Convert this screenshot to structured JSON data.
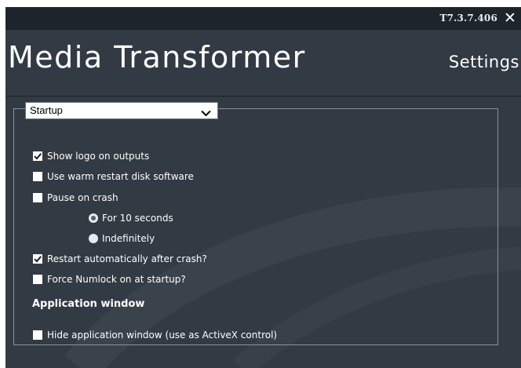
{
  "titlebar": {
    "version": "T7.3.7.406",
    "close_icon": "close-icon"
  },
  "header": {
    "app_title": "Media Transformer",
    "page_title": "Settings"
  },
  "settings": {
    "section_dropdown": {
      "selected": "Startup",
      "icon": "chevron-down-icon"
    },
    "options": {
      "show_logo": {
        "label": "Show logo on outputs",
        "checked": true
      },
      "warm_restart": {
        "label": "Use warm restart disk software",
        "checked": false
      },
      "pause_on_crash": {
        "label": "Pause on crash",
        "checked": false
      },
      "pause_10_seconds": {
        "label": "For 10 seconds",
        "selected": true
      },
      "pause_indefinitely": {
        "label": "Indefinitely",
        "selected": false
      },
      "restart_auto": {
        "label": "Restart automatically after crash?",
        "checked": true
      },
      "force_numlock": {
        "label": "Force Numlock on at startup?",
        "checked": false
      }
    },
    "application_window": {
      "heading": "Application window",
      "hide_app_window": {
        "label": "Hide application window (use as ActiveX control)",
        "checked": false
      }
    }
  },
  "colors": {
    "background": "#323a43",
    "titlebar": "#1e242b",
    "text": "#ffffff",
    "panel_border": "#8a939c"
  }
}
